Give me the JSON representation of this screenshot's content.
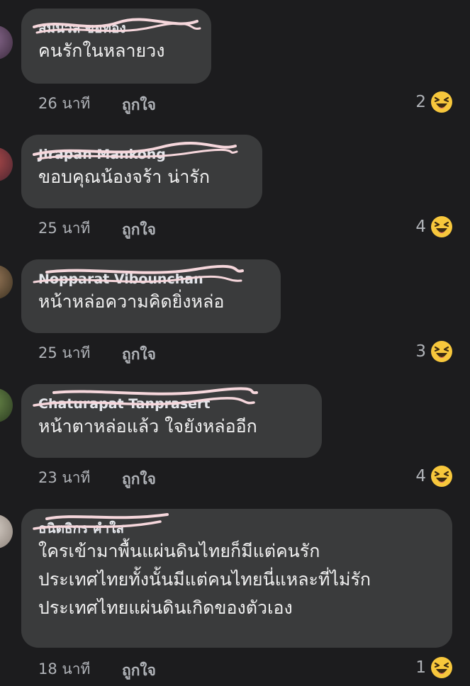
{
  "comments": [
    {
      "author": "สมนวล ขอทอง",
      "text_lines": [
        "คนรักในหลายวง"
      ],
      "time": "26 นาที",
      "like_label": "ถูกใจ",
      "reaction_count": "2",
      "reaction_icon": "haha-icon"
    },
    {
      "author": "Jirapan Mankong",
      "text_lines": [
        "ขอบคุณน้องจร้า  น่ารัก"
      ],
      "time": "25 นาที",
      "like_label": "ถูกใจ",
      "reaction_count": "4",
      "reaction_icon": "haha-icon"
    },
    {
      "author": "Nopparat Vibounchan",
      "text_lines": [
        "หน้าหล่อความคิดยิ่งหล่อ"
      ],
      "time": "25 นาที",
      "like_label": "ถูกใจ",
      "reaction_count": "3",
      "reaction_icon": "haha-icon"
    },
    {
      "author": "Chaturapat Tanprasert",
      "text_lines": [
        "หน้าตาหล่อแล้ว  ใจยังหล่ออีก"
      ],
      "time": "23 นาที",
      "like_label": "ถูกใจ",
      "reaction_count": "4",
      "reaction_icon": "haha-icon"
    },
    {
      "author": "ธนิตธิกร คำใส",
      "text_lines": [
        "ใครเข้ามาพื้นแผ่นดินไทยก็มีแต่คนรัก",
        "ประเทศไทยทั้งนั้นมีแต่คนไทยนี่แหละที่ไม่รัก",
        "ประเทศไทยแผ่นดินเกิดของตัวเอง"
      ],
      "time": "18 นาที",
      "like_label": "ถูกใจ",
      "reaction_count": "1",
      "reaction_icon": "haha-icon"
    }
  ],
  "colors": {
    "background": "#1c1c1e",
    "bubble": "#3a3b3c",
    "meta_text": "#b0b3b8",
    "scribble": "#f6d7dc",
    "haha_face": "#f7c73c"
  }
}
